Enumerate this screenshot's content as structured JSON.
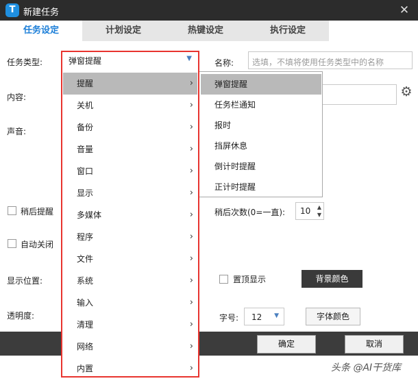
{
  "window": {
    "title": "新建任务",
    "logo_letter": "T",
    "close_glyph": "✕"
  },
  "tabs": [
    {
      "label": "任务设定",
      "active": true
    },
    {
      "label": "计划设定",
      "active": false
    },
    {
      "label": "热键设定",
      "active": false
    },
    {
      "label": "执行设定",
      "active": false
    }
  ],
  "form": {
    "task_type_label": "任务类型:",
    "task_type_value": "弹窗提醒",
    "name_label": "名称:",
    "name_placeholder": "选填，不填将使用任务类型中的名称",
    "content_label": "内容:",
    "sound_label": "声音:",
    "remind_later_label": "稍后提醒",
    "remind_count_label": "稍后次数(0=一直):",
    "remind_count_value": "10",
    "auto_close_label": "自动关闭",
    "display_pos_label": "显示位置:",
    "top_most_label": "置顶显示",
    "bg_color_button": "背景颜色",
    "opacity_label": "透明度:",
    "font_size_label": "字号:",
    "font_size_value": "12",
    "font_color_button": "字体颜色"
  },
  "footer": {
    "ok_label": "确定",
    "cancel_label": "取消"
  },
  "dropdown_menu": {
    "items": [
      "提醒",
      "关机",
      "备份",
      "音量",
      "窗口",
      "显示",
      "多媒体",
      "程序",
      "文件",
      "系统",
      "输入",
      "清理",
      "网络",
      "内置"
    ],
    "highlighted": "提醒",
    "chevron": "›"
  },
  "submenu": {
    "items": [
      "弹窗提醒",
      "任务栏通知",
      "报时",
      "挡屏休息",
      "倒计时提醒",
      "正计时提醒"
    ],
    "highlighted": "弹窗提醒"
  },
  "watermark": "头条 @AI干货库",
  "colors": {
    "accent_tab": "#1d7fd8",
    "annotation_outline": "#e8332e",
    "menu_highlight": "#b9b9b9"
  }
}
